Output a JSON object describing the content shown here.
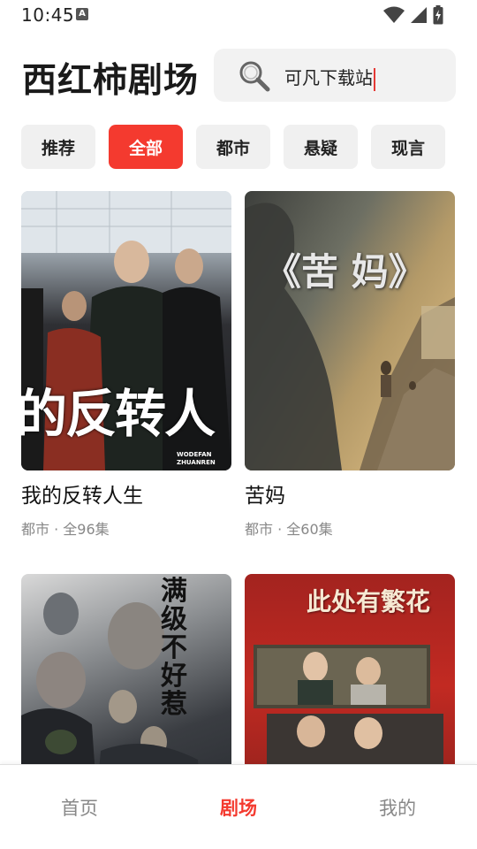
{
  "status_bar": {
    "time": "10:45",
    "badge": "A"
  },
  "header": {
    "title": "西红柿剧场",
    "search": {
      "value": "可凡下载站"
    }
  },
  "tabs": [
    {
      "label": "推荐",
      "active": false
    },
    {
      "label": "全部",
      "active": true
    },
    {
      "label": "都市",
      "active": false
    },
    {
      "label": "悬疑",
      "active": false
    },
    {
      "label": "现言",
      "active": false
    }
  ],
  "dramas": [
    {
      "title": "我的反转人生",
      "meta": "都市 · 全96集",
      "poster_text": "的反转人",
      "poster_sub": "WODEFAN ZHUANREN"
    },
    {
      "title": "苦妈",
      "meta": "都市 · 全60集",
      "poster_text": "《苦 妈》"
    },
    {
      "title": "",
      "meta": "",
      "poster_text": "满级不好惹"
    },
    {
      "title": "",
      "meta": "",
      "poster_text": "此处有繁花"
    }
  ],
  "bottom_nav": [
    {
      "label": "首页",
      "active": false
    },
    {
      "label": "剧场",
      "active": true
    },
    {
      "label": "我的",
      "active": false
    }
  ],
  "colors": {
    "accent": "#f43a2f",
    "tab_bg": "#f0f0f0",
    "search_bg": "#f2f2f2"
  }
}
